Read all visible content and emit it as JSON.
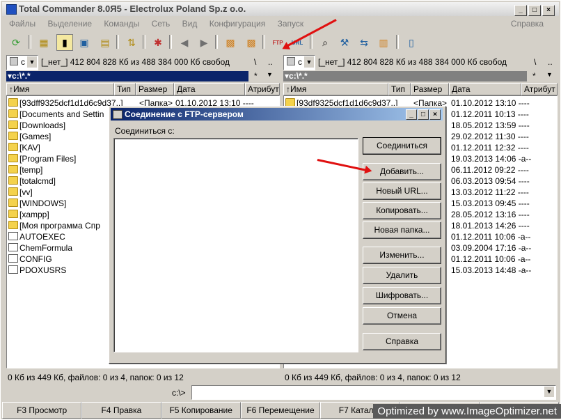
{
  "window": {
    "title": "Total Commander 8.0Я5 - Electrolux Poland Sp.z o.o."
  },
  "menu": [
    "Файлы",
    "Выделение",
    "Команды",
    "Сеть",
    "Вид",
    "Конфигурация",
    "Запуск"
  ],
  "menu_right": "Справка",
  "left": {
    "drive": "c",
    "drive_info": "[_нет_]  412 804 828 Кб из 488 384 000 Кб свобод",
    "root_btn": "\\",
    "up_btn": "..",
    "path": "c:\\*.*",
    "cols": [
      "↑Имя",
      "Тип",
      "Размер",
      "Дата",
      "Атрибут"
    ],
    "rows": [
      {
        "name": "[93dff9325dcf1d1d6c9d37..]",
        "type": "<Папка>",
        "date": "01.10.2012 13:10 ----"
      },
      {
        "name": "[Documents and Settin"
      },
      {
        "name": "[Downloads]"
      },
      {
        "name": "[Games]"
      },
      {
        "name": "[KAV]"
      },
      {
        "name": "[Program Files]"
      },
      {
        "name": "[temp]"
      },
      {
        "name": "[totalcmd]"
      },
      {
        "name": "[vv]"
      },
      {
        "name": "[WINDOWS]"
      },
      {
        "name": "[xampp]"
      },
      {
        "name": "[Моя программа Спр"
      },
      {
        "name": "AUTOEXEC"
      },
      {
        "name": "ChemFormula"
      },
      {
        "name": "CONFIG"
      },
      {
        "name": "PDOXUSRS"
      }
    ],
    "status": "0 Кб из 449 Кб, файлов: 0 из 4, папок: 0 из 12"
  },
  "right": {
    "drive": "c",
    "drive_info": "[_нет_]  412 804 828 Кб из 488 384 000 Кб свобод",
    "root_btn": "\\",
    "up_btn": "..",
    "path": "c:\\*.*",
    "cols": [
      "↑Имя",
      "Тип",
      "Размер",
      "Дата",
      "Атрибут"
    ],
    "rows": [
      {
        "name": "[93df9325dcf1d1d6c9d37..]",
        "type": "<Папка>",
        "date": "01.10.2012 13:10 ----"
      },
      {
        "date": "01.12.2011 10:13 ----"
      },
      {
        "date": "18.05.2012 13:59 ----"
      },
      {
        "date": "29.02.2012 11:30 ----"
      },
      {
        "date": "01.12.2011 12:32 ----"
      },
      {
        "date": "19.03.2013 14:06 -a--"
      },
      {
        "date": "06.11.2012 09:22 ----"
      },
      {
        "date": "06.03.2013 09:54 ----"
      },
      {
        "date": "13.03.2012 11:22 ----"
      },
      {
        "date": "15.03.2013 09:45 ----"
      },
      {
        "date": "28.05.2012 13:16 ----"
      },
      {
        "date": "18.01.2013 14:26 ----"
      },
      {
        "date": "01.12.2011 10:06 -a--"
      },
      {
        "date": "03.09.2004 17:16 -a--"
      },
      {
        "date": "01.12.2011 10:06 -a--"
      },
      {
        "date": "15.03.2013 14:48 -a--"
      }
    ],
    "status": "0 Кб из 449 Кб, файлов: 0 из 4, папок: 0 из 12"
  },
  "cmd_prompt": "c:\\>",
  "fkeys": [
    "F3 Просмотр",
    "F4 Правка",
    "F5 Копирование",
    "F6 Перемещение",
    "F7 Каталог",
    "",
    "",
    ""
  ],
  "dialog": {
    "title": "Соединение с FTP-сервером",
    "label": "Соединиться с:",
    "buttons": [
      "Соединиться",
      "Добавить...",
      "Новый URL...",
      "Копировать...",
      "Новая папка...",
      "Изменить...",
      "Удалить",
      "Шифровать...",
      "Отмена",
      "Справка"
    ]
  },
  "watermark": "Optimized by www.ImageOptimizer.net",
  "colors": {
    "accent": "#0a246a",
    "arrow": "#e01010"
  }
}
